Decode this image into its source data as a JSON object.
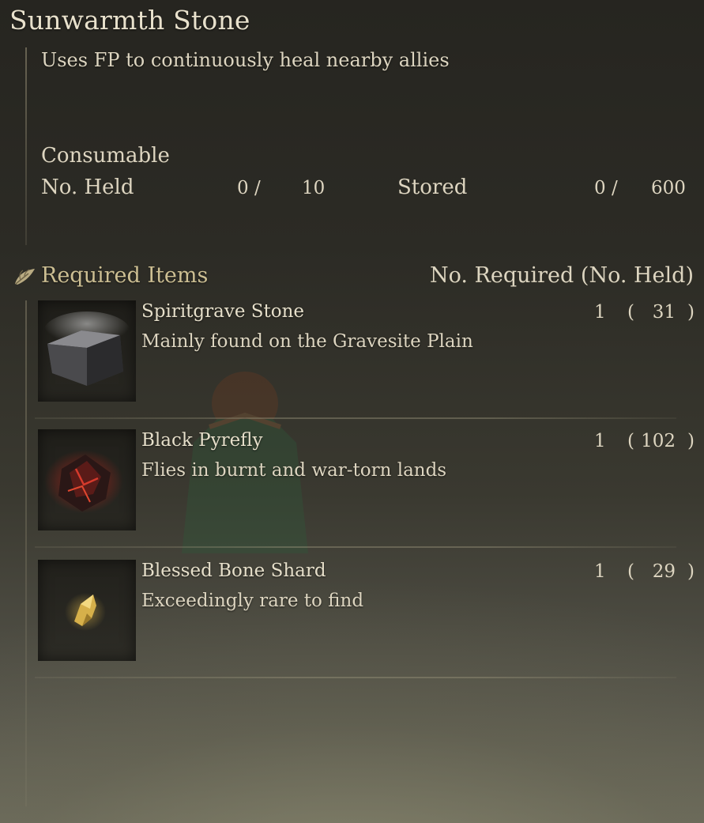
{
  "item": {
    "name": "Sunwarmth Stone",
    "description": "Uses FP to continuously heal nearby allies",
    "category": "Consumable",
    "held_label": "No. Held",
    "held_value": "0 /",
    "held_max": "10",
    "stored_label": "Stored",
    "stored_value": "0 /",
    "stored_max": "600"
  },
  "required": {
    "title": "Required Items",
    "column_label": "No. Required (No. Held)",
    "icon": "crafting-leaf-icon",
    "items": [
      {
        "name": "Spiritgrave Stone",
        "description": "Mainly found on the Gravesite Plain",
        "required": "1",
        "open": "(",
        "held": "31",
        "close": ")",
        "icon": "spiritgrave-stone-icon"
      },
      {
        "name": "Black Pyrefly",
        "description": "Flies in burnt and war-torn lands",
        "required": "1",
        "open": "(",
        "held": "102",
        "close": ")",
        "icon": "black-pyrefly-icon"
      },
      {
        "name": "Blessed Bone Shard",
        "description": "Exceedingly rare to find",
        "required": "1",
        "open": "(",
        "held": "29",
        "close": ")",
        "icon": "blessed-bone-shard-icon"
      }
    ]
  },
  "colors": {
    "accent_gold": "#cdbf93",
    "text": "#ddd5c0"
  }
}
